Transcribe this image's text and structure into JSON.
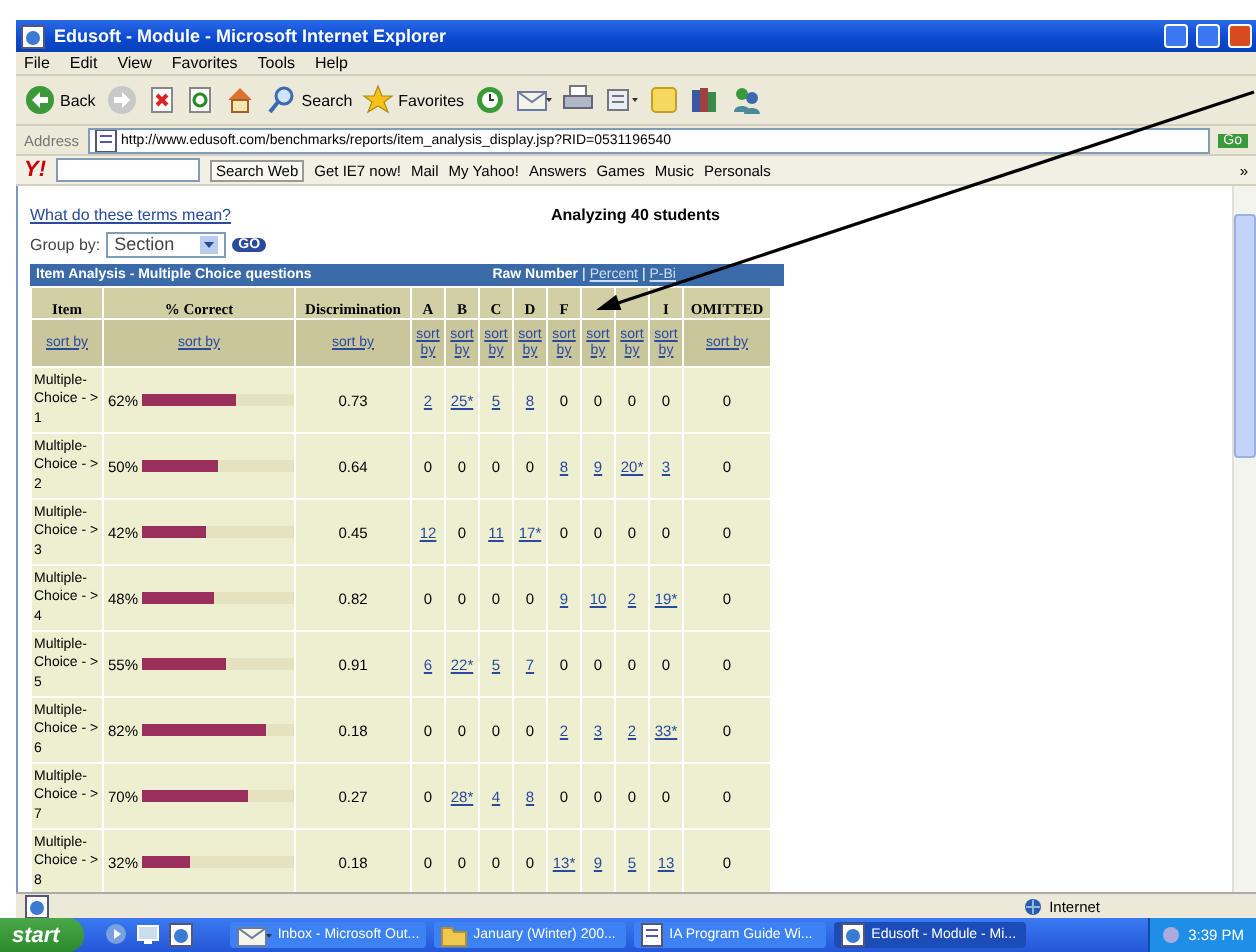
{
  "window": {
    "title": "Edusoft - Module - Microsoft Internet Explorer"
  },
  "menu": [
    "File",
    "Edit",
    "View",
    "Favorites",
    "Tools",
    "Help"
  ],
  "toolbar": [
    {
      "kind": "back",
      "label": "Back"
    },
    {
      "kind": "forward"
    },
    {
      "kind": "stop"
    },
    {
      "kind": "refresh"
    },
    {
      "kind": "home"
    },
    {
      "kind": "search",
      "label": "Search"
    },
    {
      "kind": "favorites",
      "label": "Favorites"
    },
    {
      "kind": "history"
    },
    {
      "kind": "mail"
    },
    {
      "kind": "print"
    },
    {
      "kind": "edit"
    },
    {
      "kind": "note"
    },
    {
      "kind": "research"
    },
    {
      "kind": "messenger"
    }
  ],
  "address": {
    "label": "Address",
    "url": "http://www.edusoft.com/benchmarks/reports/item_analysis_display.jsp?RID=0531196540",
    "go": "Go"
  },
  "yahoo_bar": {
    "logo": "Y!",
    "search_button": "Search Web",
    "items": [
      "Get IE7 now!",
      "Mail",
      "My Yahoo!",
      "Answers",
      "Games",
      "Music",
      "Personals"
    ],
    "more": "»"
  },
  "page": {
    "help_link": "What do these terms mean?",
    "summary": "Analyzing 40 students",
    "group_by": {
      "label": "Group by:",
      "value": "Section",
      "button": "GO"
    },
    "table": {
      "title": "Item Analysis - Multiple Choice questions",
      "view_separator": "|",
      "views": [
        {
          "label": "Raw Number",
          "selected": true
        },
        {
          "label": "Percent",
          "selected": false
        },
        {
          "label": "P-Bi",
          "selected": false
        }
      ],
      "columns": [
        {
          "label": "Item",
          "sort": "sort by"
        },
        {
          "label": "% Correct",
          "sort": "sort by"
        },
        {
          "label": "Discrimination",
          "sort": "sort by"
        },
        {
          "label": "A",
          "sort": "sort by"
        },
        {
          "label": "B",
          "sort": "sort by"
        },
        {
          "label": "C",
          "sort": "sort by"
        },
        {
          "label": "D",
          "sort": "sort by"
        },
        {
          "label": "F",
          "sort": "sort by"
        },
        {
          "sort": "sort by"
        },
        {
          "sort": "sort by"
        },
        {
          "label": "I",
          "sort": "sort by"
        },
        {
          "label": "OMITTED",
          "sort": "sort by"
        }
      ],
      "rows": [
        {
          "item": "Multiple-Choice - > 1",
          "percent": "62%",
          "level": 0.62,
          "discrimination": "0.73",
          "answers": [
            {
              "value": "2",
              "link": true
            },
            {
              "value": "25*",
              "link": true
            },
            {
              "value": "5",
              "link": true
            },
            {
              "value": "8",
              "link": true
            },
            {
              "value": "0",
              "link": false
            },
            {
              "value": "0",
              "link": false
            },
            {
              "value": "0",
              "link": false
            },
            {
              "value": "0",
              "link": false
            }
          ],
          "omitted": "0"
        },
        {
          "item": "Multiple-Choice - > 2",
          "percent": "50%",
          "level": 0.5,
          "discrimination": "0.64",
          "answers": [
            {
              "value": "0",
              "link": false
            },
            {
              "value": "0",
              "link": false
            },
            {
              "value": "0",
              "link": false
            },
            {
              "value": "0",
              "link": false
            },
            {
              "value": "8",
              "link": true
            },
            {
              "value": "9",
              "link": true
            },
            {
              "value": "20*",
              "link": true
            },
            {
              "value": "3",
              "link": true
            }
          ],
          "omitted": "0"
        },
        {
          "item": "Multiple-Choice - > 3",
          "percent": "42%",
          "level": 0.42,
          "discrimination": "0.45",
          "answers": [
            {
              "value": "12",
              "link": true
            },
            {
              "value": "0",
              "link": false
            },
            {
              "value": "11",
              "link": true
            },
            {
              "value": "17*",
              "link": true
            },
            {
              "value": "0",
              "link": false
            },
            {
              "value": "0",
              "link": false
            },
            {
              "value": "0",
              "link": false
            },
            {
              "value": "0",
              "link": false
            }
          ],
          "omitted": "0"
        },
        {
          "item": "Multiple-Choice - > 4",
          "percent": "48%",
          "level": 0.48,
          "discrimination": "0.82",
          "answers": [
            {
              "value": "0",
              "link": false
            },
            {
              "value": "0",
              "link": false
            },
            {
              "value": "0",
              "link": false
            },
            {
              "value": "0",
              "link": false
            },
            {
              "value": "9",
              "link": true
            },
            {
              "value": "10",
              "link": true
            },
            {
              "value": "2",
              "link": true
            },
            {
              "value": "19*",
              "link": true
            }
          ],
          "omitted": "0"
        },
        {
          "item": "Multiple-Choice - > 5",
          "percent": "55%",
          "level": 0.55,
          "discrimination": "0.91",
          "answers": [
            {
              "value": "6",
              "link": true
            },
            {
              "value": "22*",
              "link": true
            },
            {
              "value": "5",
              "link": true
            },
            {
              "value": "7",
              "link": true
            },
            {
              "value": "0",
              "link": false
            },
            {
              "value": "0",
              "link": false
            },
            {
              "value": "0",
              "link": false
            },
            {
              "value": "0",
              "link": false
            }
          ],
          "omitted": "0"
        },
        {
          "item": "Multiple-Choice - > 6",
          "percent": "82%",
          "level": 0.82,
          "discrimination": "0.18",
          "answers": [
            {
              "value": "0",
              "link": false
            },
            {
              "value": "0",
              "link": false
            },
            {
              "value": "0",
              "link": false
            },
            {
              "value": "0",
              "link": false
            },
            {
              "value": "2",
              "link": true
            },
            {
              "value": "3",
              "link": true
            },
            {
              "value": "2",
              "link": true
            },
            {
              "value": "33*",
              "link": true
            }
          ],
          "omitted": "0"
        },
        {
          "item": "Multiple-Choice - > 7",
          "percent": "70%",
          "level": 0.7,
          "discrimination": "0.27",
          "answers": [
            {
              "value": "0",
              "link": false
            },
            {
              "value": "28*",
              "link": true
            },
            {
              "value": "4",
              "link": true
            },
            {
              "value": "8",
              "link": true
            },
            {
              "value": "0",
              "link": false
            },
            {
              "value": "0",
              "link": false
            },
            {
              "value": "0",
              "link": false
            },
            {
              "value": "0",
              "link": false
            }
          ],
          "omitted": "0"
        },
        {
          "item": "Multiple-Choice - > 8",
          "percent": "32%",
          "level": 0.32,
          "discrimination": "0.18",
          "answers": [
            {
              "value": "0",
              "link": false
            },
            {
              "value": "0",
              "link": false
            },
            {
              "value": "0",
              "link": false
            },
            {
              "value": "0",
              "link": false
            },
            {
              "value": "13*",
              "link": true
            },
            {
              "value": "9",
              "link": true
            },
            {
              "value": "5",
              "link": true
            },
            {
              "value": "13",
              "link": true
            }
          ],
          "omitted": "0"
        }
      ]
    }
  },
  "status_bar": {
    "zone": "Internet"
  },
  "taskbar": {
    "start": "start",
    "tasks": [
      {
        "label": "Inbox - Microsoft Out...",
        "kind": "mail",
        "selected": false
      },
      {
        "label": "January (Winter) 200...",
        "kind": "folder",
        "selected": false
      },
      {
        "label": "IA Program Guide Wi...",
        "kind": "document",
        "selected": false
      },
      {
        "label": "Edusoft - Module - Mi...",
        "kind": "browser",
        "selected": true
      }
    ],
    "clock": "3:39 PM"
  }
}
